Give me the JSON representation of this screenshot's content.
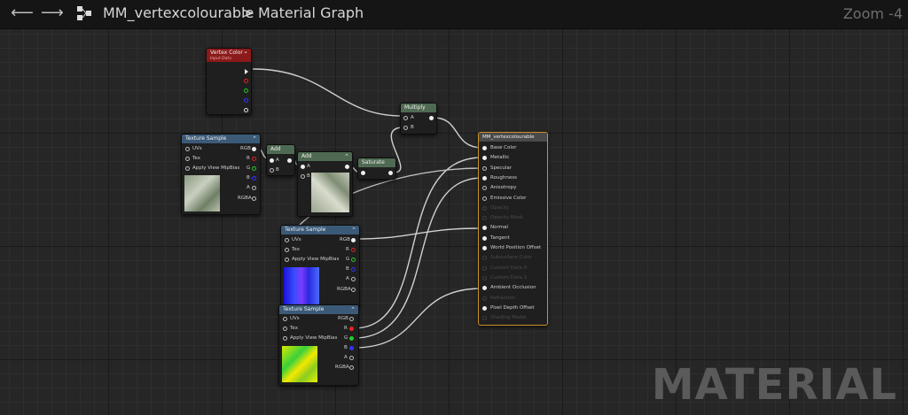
{
  "toolbar": {
    "asset_name": "MM_vertexcolourable",
    "separator": ">",
    "graph_name": "Material Graph",
    "zoom": "Zoom -4"
  },
  "vertex_color": {
    "title": "Vertex Color",
    "subtitle": "Input Data"
  },
  "tex1": {
    "title": "Texture Sample",
    "uvs": "UVs",
    "tex": "Tex",
    "mip": "Apply View MipBias",
    "rgb": "RGB",
    "r": "R",
    "g": "G",
    "b": "B",
    "a": "A",
    "rgba": "RGBA"
  },
  "add1": {
    "title": "Add",
    "a": "A",
    "b": "B"
  },
  "add2": {
    "title": "Add",
    "a": "A",
    "b": "B"
  },
  "saturate": {
    "title": "Saturate"
  },
  "multiply": {
    "title": "Multiply",
    "a": "A",
    "b": "B"
  },
  "tex2": {
    "title": "Texture Sample",
    "uvs": "UVs",
    "tex": "Tex",
    "mip": "Apply View MipBias",
    "rgb": "RGB",
    "r": "R",
    "g": "G",
    "b": "B",
    "a": "A",
    "rgba": "RGBA"
  },
  "tex3": {
    "title": "Texture Sample",
    "uvs": "UVs",
    "tex": "Tex",
    "mip": "Apply View MipBias",
    "rgb": "RGB",
    "r": "R",
    "g": "G",
    "b": "B",
    "a": "A",
    "rgba": "RGBA"
  },
  "material": {
    "title": "MM_vertexcolourable",
    "inputs": [
      "Base Color",
      "Metallic",
      "Specular",
      "Roughness",
      "Anisotropy",
      "Emissive Color",
      "Opacity",
      "Opacity Mask",
      "Normal",
      "Tangent",
      "World Position Offset",
      "Subsurface Color",
      "Custom Data 0",
      "Custom Data 1",
      "Ambient Occlusion",
      "Refraction",
      "Pixel Depth Offset",
      "Shading Model"
    ]
  },
  "watermark": "MATERIAL",
  "colors": {
    "vertex_header": "#8c1a1a",
    "texture_header": "#3b5a78",
    "math_header": "#4f6a52",
    "material_border": "#c8902c"
  }
}
